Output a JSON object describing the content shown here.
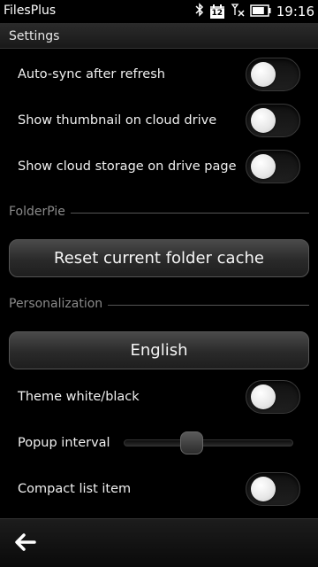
{
  "statusbar": {
    "app_title": "FilesPlus",
    "calendar_day": "12",
    "clock": "19:16",
    "battery_level": 0.8
  },
  "titlebar": {
    "title": "Settings"
  },
  "settings": {
    "autosync_label": "Auto-sync after refresh",
    "thumbnail_label": "Show thumbnail on cloud drive",
    "cloud_storage_label": "Show cloud storage on drive page"
  },
  "folderpie": {
    "section_label": "FolderPie",
    "reset_button_label": "Reset current folder cache"
  },
  "personalization": {
    "section_label": "Personalization",
    "language_button_label": "English",
    "theme_label": "Theme white/black",
    "popup_label": "Popup interval",
    "popup_interval_level": 0.4,
    "compact_label": "Compact list item"
  },
  "toolbar": {
    "back_icon": "back-arrow-icon"
  }
}
